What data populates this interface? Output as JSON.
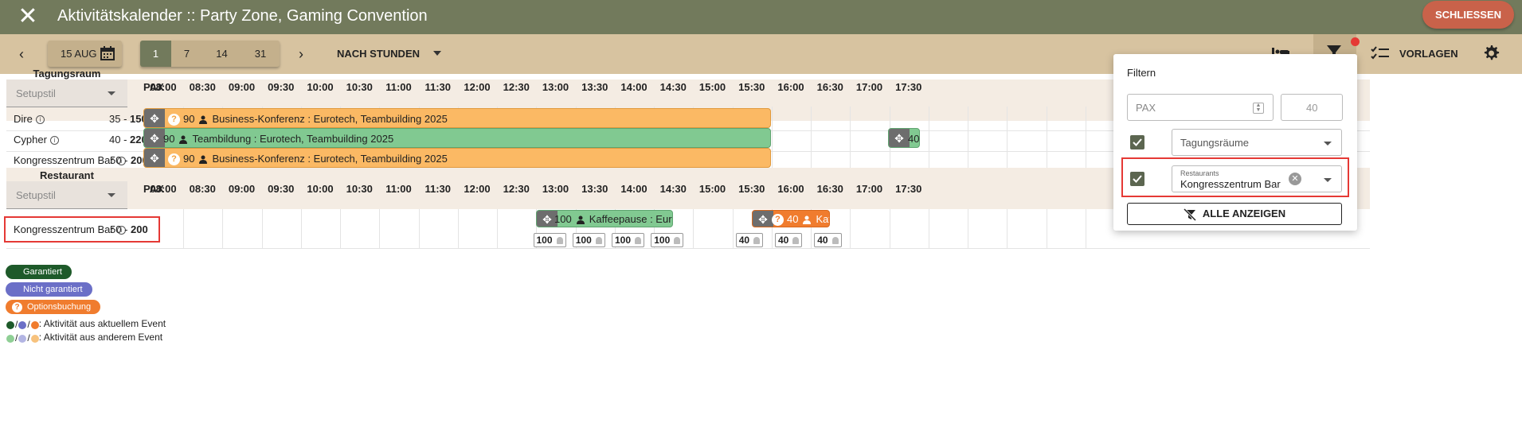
{
  "header": {
    "title": "Aktivitätskalender :: Party Zone, Gaming Convention",
    "close_app_label": "SCHLIESSEN"
  },
  "toolbar": {
    "date_label": "15 AUG",
    "day_segments": [
      "1",
      "7",
      "14",
      "31"
    ],
    "selected_segment": "1",
    "hours_mode_label": "NACH STUNDEN",
    "templates_label": "VORLAGEN"
  },
  "times": [
    "08:00",
    "08:30",
    "09:00",
    "09:30",
    "10:00",
    "10:30",
    "11:00",
    "11:30",
    "12:00",
    "12:30",
    "13:00",
    "13:30",
    "14:00",
    "14:30",
    "15:00",
    "15:30",
    "16:00",
    "16:30",
    "17:00",
    "17:30"
  ],
  "sections": {
    "meeting": {
      "name": "Tagungsraum",
      "setup_placeholder": "Setupstil",
      "pax_header": "PAX",
      "rooms": [
        {
          "name": "Dire",
          "pax_min": "35",
          "pax_max": "150"
        },
        {
          "name": "Cypher",
          "pax_min": "40",
          "pax_max": "220"
        },
        {
          "name": "Kongresszentrum Bar",
          "pax_min": "50",
          "pax_max": "200"
        }
      ]
    },
    "restaurant": {
      "name": "Restaurant",
      "setup_placeholder": "Setupstil",
      "pax_header": "PAX",
      "rooms": [
        {
          "name": "Kongresszentrum Bar",
          "pax_min": "50",
          "pax_max": "200"
        }
      ]
    }
  },
  "events": {
    "dire": {
      "count": "90",
      "label": "Business-Konferenz : Eurotech, Teambuilding 2025",
      "q": "?"
    },
    "cypher": {
      "count": "90",
      "label": "Teambildung : Eurotech, Teambuilding 2025"
    },
    "cypher_late": {
      "count": "40"
    },
    "bar": {
      "count": "90",
      "label": "Business-Konferenz : Eurotech, Teambuilding 2025",
      "q": "?"
    },
    "rest_coffee": {
      "count": "100",
      "label": "Kaffeepause : Eurotec"
    },
    "rest_coffee2": {
      "count": "40",
      "label": "Kaffe",
      "q": "?"
    }
  },
  "capacities": [
    {
      "slot": "13:00",
      "value": "100"
    },
    {
      "slot": "13:30",
      "value": "100"
    },
    {
      "slot": "14:00",
      "value": "100"
    },
    {
      "slot": "14:30",
      "value": "100"
    },
    {
      "slot": "15:30",
      "value": "40"
    },
    {
      "slot": "16:00",
      "value": "40"
    },
    {
      "slot": "16:30",
      "value": "40"
    }
  ],
  "legend": {
    "guaranteed": "Garantiert",
    "not_guaranteed": "Nicht garantiert",
    "option": "Optionsbuchung",
    "option_q": "?",
    "current_event": ": Aktivität aus aktuellem Event",
    "other_event": ": Aktivität aus anderem Event",
    "slash": "/"
  },
  "filter_panel": {
    "title": "Filtern",
    "pax_placeholder": "PAX",
    "pax_max_value": "40",
    "meeting_select": "Tagungsräume",
    "restaurant_select_label": "Restaurants",
    "restaurant_select_value": "Kongresszentrum Bar",
    "show_all_label": "ALLE ANZEIGEN"
  },
  "colors": {
    "header_bg": "#727a5c",
    "toolbar_bg": "#d7c3a0",
    "guaranteed": "#1e5a2a",
    "not_guaranteed": "#6b6fc7",
    "option": "#f07c2e"
  }
}
